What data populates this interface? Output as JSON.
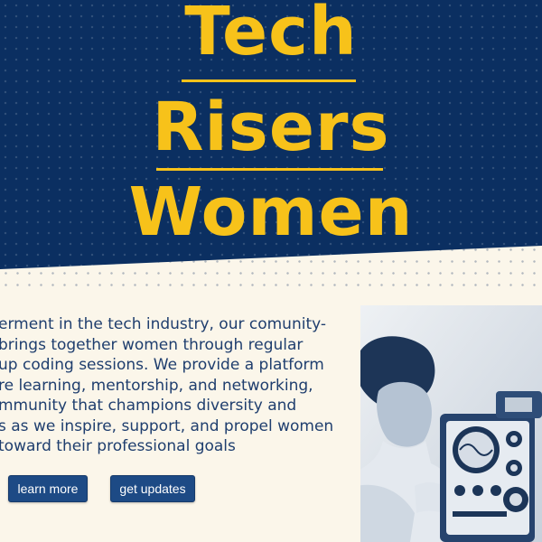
{
  "hero": {
    "title_words": [
      "Tech",
      "Risers",
      "Women"
    ]
  },
  "description": {
    "lines": [
      "erment in the tech industry, our comunity-",
      "brings together women through regular",
      "up coding sessions. We provide a platform",
      "re learning, mentorship, and networking,",
      "mmunity that champions diversity and",
      "s as we inspire, support, and propel women",
      "toward their professional goals"
    ]
  },
  "buttons": {
    "learn_more": "learn more",
    "get_updates": "get updates"
  },
  "colors": {
    "hero_background": "#0b2f61",
    "title_yellow": "#f7c21a",
    "page_background": "#fbf6ea",
    "text_blue": "#1f3e6e",
    "button_blue": "#1d4a85"
  },
  "image": {
    "icon": "vintage-photo-woman-with-oscilloscope"
  }
}
